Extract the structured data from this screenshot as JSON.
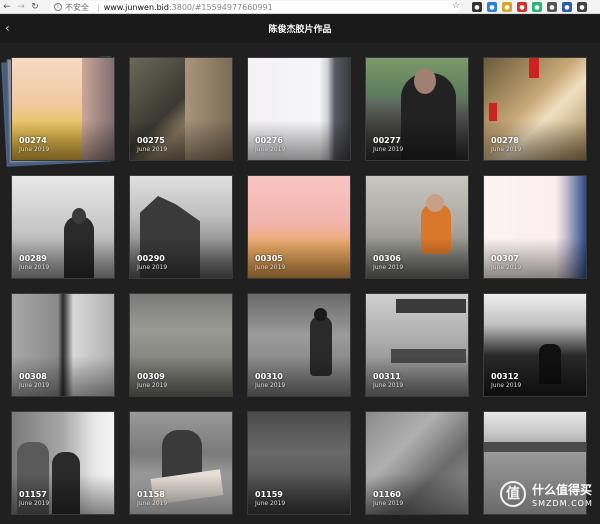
{
  "browser": {
    "insecure_label": "不安全",
    "url_host": "www.junwen.bid",
    "url_rest": ":3800/#15594977660991"
  },
  "header": {
    "title": "陈俊杰胶片作品"
  },
  "tiles": [
    {
      "num": "00274",
      "date": "June 2019"
    },
    {
      "num": "00275",
      "date": "June 2019"
    },
    {
      "num": "00276",
      "date": "June 2019"
    },
    {
      "num": "00277",
      "date": "June 2019"
    },
    {
      "num": "00278",
      "date": "June 2019"
    },
    {
      "num": "00289",
      "date": "June 2019"
    },
    {
      "num": "00290",
      "date": "June 2019"
    },
    {
      "num": "00305",
      "date": "June 2019"
    },
    {
      "num": "00306",
      "date": "June 2019"
    },
    {
      "num": "00307",
      "date": "June 2019"
    },
    {
      "num": "00308",
      "date": "June 2019"
    },
    {
      "num": "00309",
      "date": "June 2019"
    },
    {
      "num": "00310",
      "date": "June 2019"
    },
    {
      "num": "00311",
      "date": "June 2019"
    },
    {
      "num": "00312",
      "date": "June 2019"
    },
    {
      "num": "01157",
      "date": "June 2019"
    },
    {
      "num": "01158",
      "date": "June 2019"
    },
    {
      "num": "01159",
      "date": "June 2019"
    },
    {
      "num": "01160",
      "date": "June 2019"
    },
    {
      "num": "",
      "date": ""
    }
  ],
  "watermark": {
    "symbol": "值",
    "line1": "什么值得买",
    "line2": "SMZDM.COM"
  }
}
